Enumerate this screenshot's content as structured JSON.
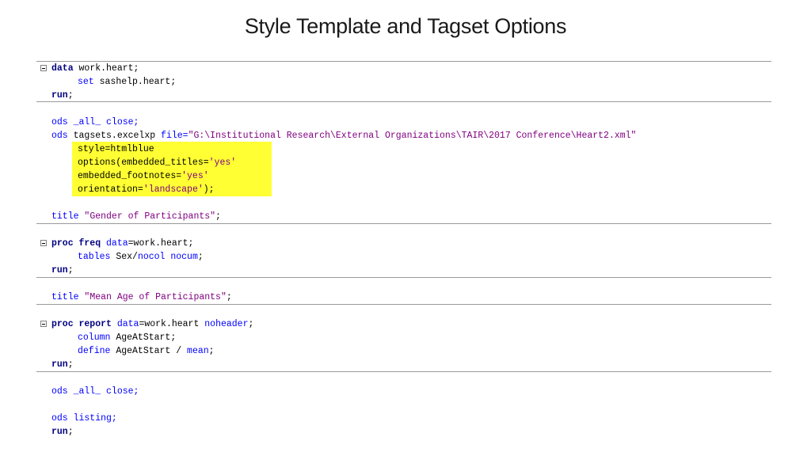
{
  "slide": {
    "title": "Style Template and Tagset Options"
  },
  "colors": {
    "highlight": "#ffff33",
    "keyword_bold": "#000080",
    "keyword": "#0000ff",
    "string": "#800080"
  },
  "code": {
    "l1": {
      "kw": "data",
      "rest": " work.heart;"
    },
    "l2": {
      "kw": "set",
      "rest": " sashelp.heart;"
    },
    "l3": {
      "kw": "run",
      "rest": ";"
    },
    "l4": {
      "text": "ods _all_ close;"
    },
    "l5": {
      "kw": "ods",
      "mid": " tagsets.excelxp ",
      "kw2": "file=",
      "str": "\"G:\\Institutional Research\\External Organizations\\TAIR\\2017 Conference\\Heart2.xml\""
    },
    "l6": {
      "text": "style=htmlblue"
    },
    "l7": {
      "pre": "options(embedded_titles=",
      "str": "'yes'"
    },
    "l8": {
      "pre": "embedded_footnotes=",
      "str": "'yes'"
    },
    "l9": {
      "pre": "orientation=",
      "str": "'landscape'",
      "post": ");"
    },
    "l10": {
      "kw": "title",
      "str": " \"Gender of Participants\"",
      "post": ";"
    },
    "l11": {
      "kw": "proc freq",
      "kw2": " data",
      "rest": "=work.heart;"
    },
    "l12": {
      "kw": "tables",
      "rest": " Sex/",
      "kw2": "nocol nocum",
      "post": ";"
    },
    "l13": {
      "kw": "run",
      "rest": ";"
    },
    "l14": {
      "kw": "title",
      "str": " \"Mean Age of Participants\"",
      "post": ";"
    },
    "l15": {
      "kw": "proc report",
      "kw2": " data",
      "rest": "=work.heart ",
      "kw3": "noheader",
      "post": ";"
    },
    "l16": {
      "kw": "column",
      "rest": " AgeAtStart;"
    },
    "l17": {
      "kw": "define",
      "rest": " AgeAtStart / ",
      "kw2": "mean",
      "post": ";"
    },
    "l18": {
      "kw": "run",
      "rest": ";"
    },
    "l19": {
      "text": "ods _all_ close;"
    },
    "l20": {
      "text": "ods listing;"
    },
    "l21": {
      "kw": "run",
      "rest": ";"
    }
  }
}
